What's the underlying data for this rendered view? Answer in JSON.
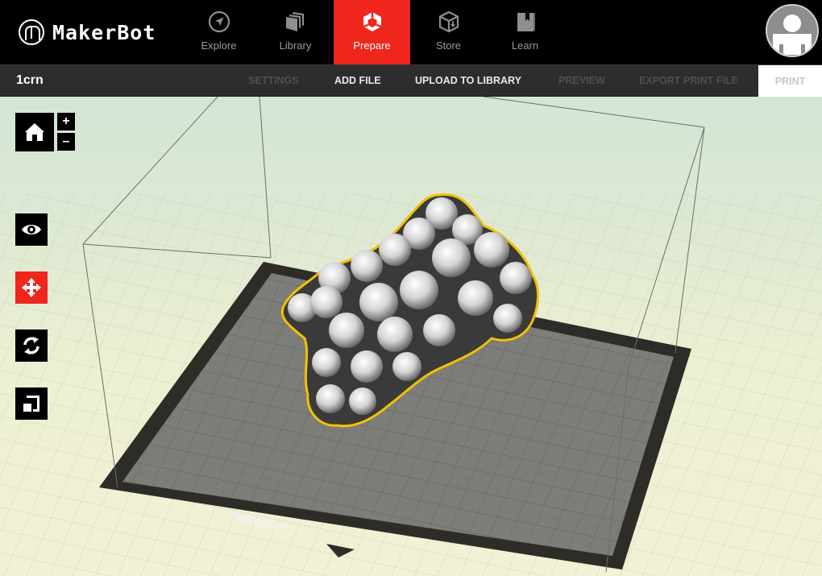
{
  "app": {
    "brand": "MakerBot"
  },
  "nav": {
    "items": [
      {
        "label": "Explore",
        "icon": "compass-icon",
        "active": false
      },
      {
        "label": "Library",
        "icon": "library-stack-icon",
        "active": false
      },
      {
        "label": "Prepare",
        "icon": "prepare-hexagon-icon",
        "active": true
      },
      {
        "label": "Store",
        "icon": "store-box-icon",
        "active": false
      },
      {
        "label": "Learn",
        "icon": "learn-book-icon",
        "active": false
      }
    ],
    "accent": "#f0251c"
  },
  "user": {
    "avatar_icon": "user-avatar-icon"
  },
  "subbar": {
    "file_name": "1crn",
    "actions": [
      {
        "label": "SETTINGS",
        "enabled": false
      },
      {
        "label": "ADD FILE",
        "enabled": true
      },
      {
        "label": "UPLOAD TO LIBRARY",
        "enabled": true
      },
      {
        "label": "PREVIEW",
        "enabled": false
      },
      {
        "label": "EXPORT PRINT FILE",
        "enabled": false
      }
    ],
    "print_label": "PRINT",
    "print_enabled": false
  },
  "viewport": {
    "camera": {
      "home_icon": "home-icon",
      "zoom_in_label": "+",
      "zoom_out_label": "–"
    },
    "tools": [
      {
        "name": "view",
        "icon": "eye-icon",
        "active": false
      },
      {
        "name": "move",
        "icon": "move-arrows-icon",
        "active": true
      },
      {
        "name": "rotate",
        "icon": "rotate-icon",
        "active": false
      },
      {
        "name": "scale",
        "icon": "scale-icon",
        "active": false
      }
    ],
    "build_plate_label": "MakerBot",
    "model": {
      "name": "1crn",
      "selected": true,
      "selection_color": "#f2c200"
    }
  }
}
